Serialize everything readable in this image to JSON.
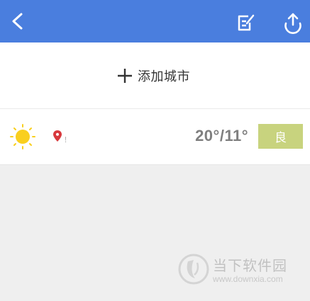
{
  "header": {
    "back_icon": "chevron-left-icon",
    "edit_icon": "edit-list-icon",
    "share_icon": "upload-share-icon",
    "bar_color": "#4a7ede"
  },
  "add_city": {
    "label": "添加城市",
    "icon": "plus-icon"
  },
  "cities": [
    {
      "weather_icon": "sun-icon",
      "location_icon": "map-pin-icon",
      "name": "！",
      "temperature": "20°/11°",
      "aqi_label": "良",
      "aqi_color": "#c8d37e"
    }
  ],
  "watermark": {
    "title": "当下软件园",
    "url": "www.downxia.com"
  }
}
